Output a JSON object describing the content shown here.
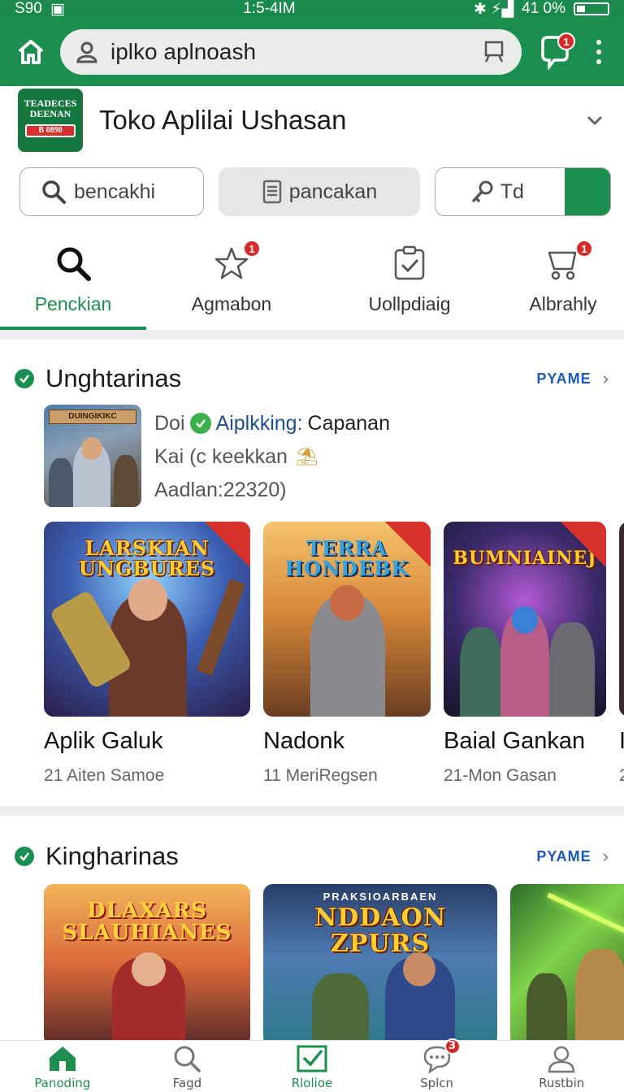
{
  "status_bar": {
    "left_text": "S90",
    "time": "1:5-4IM",
    "battery": "41 0%"
  },
  "browser": {
    "url": "iplko aplnoash",
    "notification_badge": "1"
  },
  "app": {
    "logo_line1": "TEADECES",
    "logo_line2": "DEENAN",
    "logo_badge": "B 0890",
    "title": "Toko Aplilai Ushasan"
  },
  "actions": {
    "search_label": "bencakhi",
    "doc_label": "pancakan",
    "key_label": "Td"
  },
  "tabs": [
    {
      "label": "Penckian",
      "icon": "search-icon",
      "active": true
    },
    {
      "label": "Agmabon",
      "icon": "star-icon",
      "badge": "1"
    },
    {
      "label": "Uollpdiaig",
      "icon": "clipboard-check-icon"
    },
    {
      "label": "Albrahly",
      "icon": "cart-icon",
      "badge": "1"
    }
  ],
  "section1": {
    "title": "Unghtarinas",
    "more": "PYAME",
    "featured": {
      "thumb_title": "DUINGIKIKC",
      "line1_prefix": "Doi",
      "line1_brand": "Aiplkking:",
      "line1_dev": "Capanan",
      "line2": "Kai (c keekkan",
      "line3": "Aadlan:22320)"
    },
    "cards": [
      {
        "art_title": "LARSKIAN UNGBURES",
        "name": "Aplik Galuk",
        "sub": "21 Aiten Samoe"
      },
      {
        "art_title": "TERRA HONDEBK",
        "name": "Nadonk",
        "sub": "11 MeriRegsen"
      },
      {
        "art_title": "BUMNIAINEJ",
        "name": "Baial Gankan",
        "sub": "21-Mon Gasan"
      },
      {
        "art_title": "",
        "name": "I",
        "sub": "2"
      }
    ]
  },
  "section2": {
    "title": "Kingharinas",
    "more": "PYAME",
    "cards": [
      {
        "art_title": "DLAXARS SLAUHIANES"
      },
      {
        "art_title": "NDDAON ZPURS",
        "art_subtitle": "PRAKSIOARBAEN"
      },
      {
        "art_title": ""
      }
    ]
  },
  "bottom_nav": [
    {
      "label": "Panoding",
      "icon": "home-icon",
      "active": true
    },
    {
      "label": "Fagd",
      "icon": "search-icon"
    },
    {
      "label": "Rlolioe",
      "icon": "checkbox-icon"
    },
    {
      "label": "Splcn",
      "icon": "chat-icon",
      "badge": "3"
    },
    {
      "label": "Rustbin",
      "icon": "user-icon"
    }
  ],
  "colors": {
    "brand_green": "#1c8f50",
    "badge_red": "#d62a2a",
    "link_blue": "#1c5bb5"
  }
}
